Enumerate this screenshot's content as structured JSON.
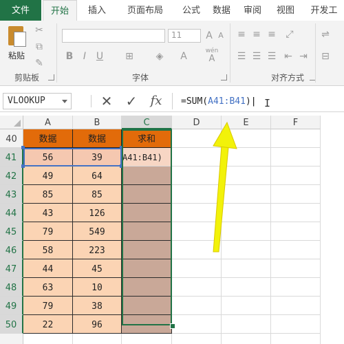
{
  "ribbon": {
    "tabs": [
      {
        "label": "文件",
        "kind": "file"
      },
      {
        "label": "开始",
        "kind": "active"
      },
      {
        "label": "插入",
        "kind": ""
      },
      {
        "label": "页面布局",
        "kind": ""
      },
      {
        "label": "公式",
        "kind": ""
      },
      {
        "label": "数据",
        "kind": ""
      },
      {
        "label": "审阅",
        "kind": ""
      },
      {
        "label": "视图",
        "kind": ""
      },
      {
        "label": "开发工",
        "kind": ""
      }
    ],
    "clipboard": {
      "paste_label": "粘贴",
      "group_label": "剪贴板"
    },
    "font": {
      "size": "11",
      "group_label": "字体",
      "buttons": [
        "B",
        "I",
        "U",
        "A",
        "A"
      ],
      "wen_label": "wén"
    },
    "alignment": {
      "group_label": "对齐方式"
    }
  },
  "formula_bar": {
    "name_box": "VLOOKUP",
    "cancel_icon": "✕",
    "enter_icon": "✓",
    "fx_label": "fx",
    "formula_prefix": "=SUM(",
    "formula_ref": "A41:B41",
    "formula_suffix": ")"
  },
  "sheet": {
    "columns": [
      "A",
      "B",
      "C",
      "D",
      "E",
      "F"
    ],
    "rows": [
      "40",
      "41",
      "42",
      "43",
      "44",
      "45",
      "46",
      "47",
      "48",
      "49",
      "50"
    ],
    "header_row": {
      "a": "数据",
      "b": "数据",
      "c": "求和"
    },
    "editing_text": "A41:B41)",
    "data": [
      [
        56,
        39
      ],
      [
        49,
        64
      ],
      [
        85,
        85
      ],
      [
        43,
        126
      ],
      [
        79,
        549
      ],
      [
        58,
        223
      ],
      [
        44,
        45
      ],
      [
        63,
        10
      ],
      [
        79,
        38
      ],
      [
        22,
        96
      ]
    ],
    "accent_color": "#217346",
    "header_fill": "#e26b0a",
    "data_fill": "#fbd4b4",
    "sum_fill": "#c9a898",
    "arrow_color": "#f2f20a"
  }
}
